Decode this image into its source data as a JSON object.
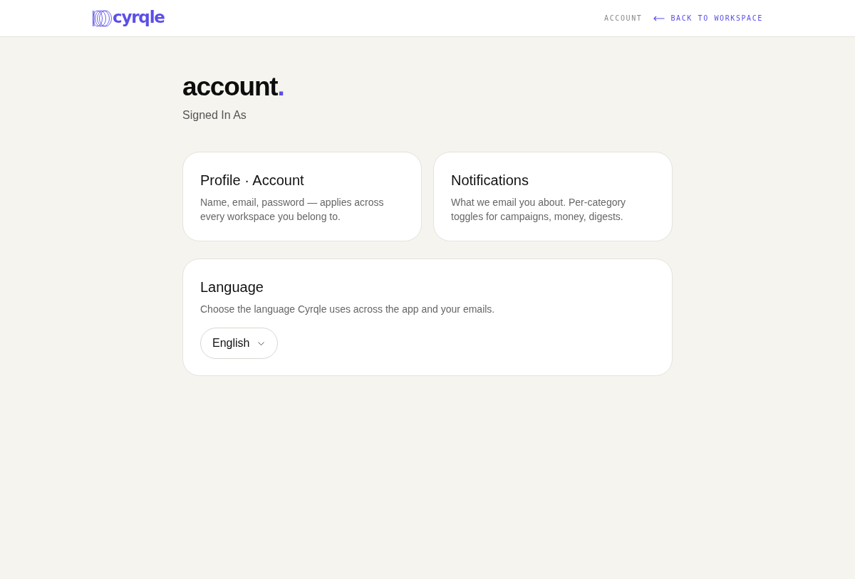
{
  "header": {
    "logo": {
      "wordmark": "cyrqle"
    },
    "nav": {
      "current": "ACCOUNT",
      "back_link": "BACK TO WORKSPACE"
    }
  },
  "page": {
    "title": "account",
    "title_accent": ".",
    "subtitle": "Signed In As"
  },
  "cards": [
    {
      "kind": "link",
      "title": "Profile · Account",
      "description": "Name, email, password — applies across every workspace you belong to."
    },
    {
      "kind": "link",
      "title": "Notifications",
      "description": "What we email you about. Per-category toggles for campaigns, money, digests."
    },
    {
      "kind": "select",
      "title": "Language",
      "description": "Choose the language Cyrqle uses across the app and your emails.",
      "select": {
        "value": "English"
      }
    }
  ]
}
